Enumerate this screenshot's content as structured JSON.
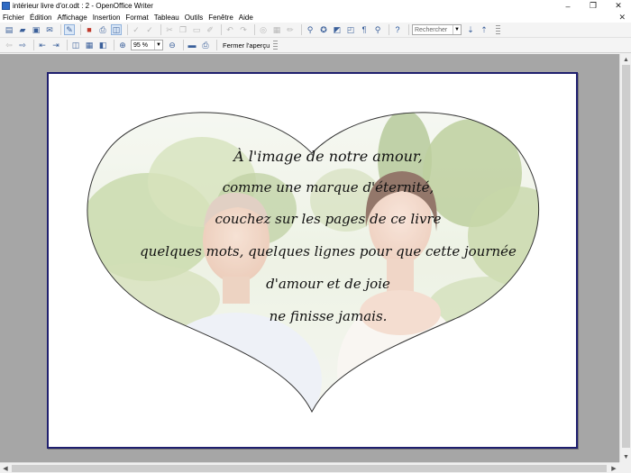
{
  "window": {
    "title": "intérieur livre d'or.odt : 2 - OpenOffice Writer",
    "controls": {
      "minimize": "–",
      "maximize": "❐",
      "close": "✕"
    }
  },
  "menu": {
    "items": [
      "Fichier",
      "Édition",
      "Affichage",
      "Insertion",
      "Format",
      "Tableau",
      "Outils",
      "Fenêtre",
      "Aide"
    ],
    "close_doc": "✕"
  },
  "toolbar1": {
    "search_placeholder": "Rechercher",
    "icons": [
      "new-icon",
      "open-icon",
      "save-icon",
      "email-icon",
      "edit-file-icon",
      "export-pdf-icon",
      "print-icon",
      "page-preview-icon",
      "spellcheck-icon",
      "autospell-icon",
      "cut-icon",
      "copy-icon",
      "paste-icon",
      "clone-icon",
      "undo-icon",
      "redo-icon",
      "hyperlink-icon",
      "table-icon",
      "draw-icon",
      "find-replace-icon",
      "navigator-icon",
      "gallery-icon",
      "datasource-icon",
      "nonprinting-icon",
      "zoom-icon",
      "help-icon",
      "find-next-icon",
      "find-prev-icon"
    ]
  },
  "toolbar2": {
    "zoom_value": "95 %",
    "close_preview_label": "Fermer l'aperçu"
  },
  "poem": {
    "lines": [
      "À l'image de notre amour,",
      "comme une marque d'éternité,",
      "couchez sur les pages de ce livre",
      "quelques mots, quelques lignes pour que cette journée",
      "d'amour et de joie",
      "ne finisse jamais."
    ]
  },
  "colors": {
    "page_border": "#1f1f6e",
    "workspace": "#a6a6a6",
    "accent": "#3a5f9a"
  }
}
